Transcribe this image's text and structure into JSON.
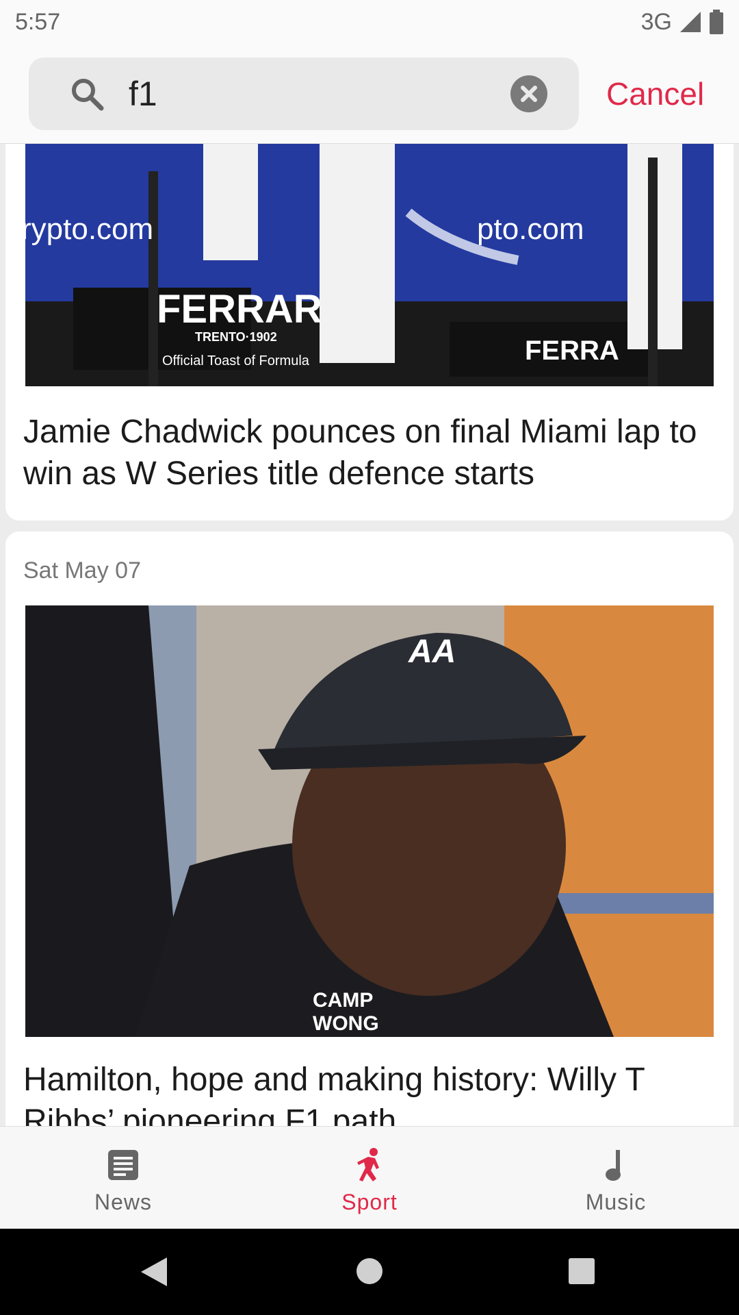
{
  "status_bar": {
    "time": "5:57",
    "network": "3G"
  },
  "search": {
    "query": "f1",
    "cancel_label": "Cancel"
  },
  "feed": {
    "articles": [
      {
        "title": "Jamie Chadwick pounces on final Miami lap to win as W Series title defence starts",
        "image_text": [
          "rypto.com",
          "pto.com",
          "FERRAR",
          "TRENTO·1902",
          "Official Toast of Formula",
          "FERRA"
        ]
      },
      {
        "date": "Sat May 07",
        "title": "Hamilton, hope and making history: Willy T Ribbs’ pioneering F1 path",
        "image_text": [
          "AA",
          "CAMP",
          "WONG"
        ]
      }
    ]
  },
  "bottom_nav": {
    "items": [
      {
        "label": "News",
        "icon": "news-icon",
        "active": false
      },
      {
        "label": "Sport",
        "icon": "sport-icon",
        "active": true
      },
      {
        "label": "Music",
        "icon": "music-icon",
        "active": false
      }
    ]
  },
  "colors": {
    "accent": "#e0294a",
    "inactive": "#666666"
  }
}
